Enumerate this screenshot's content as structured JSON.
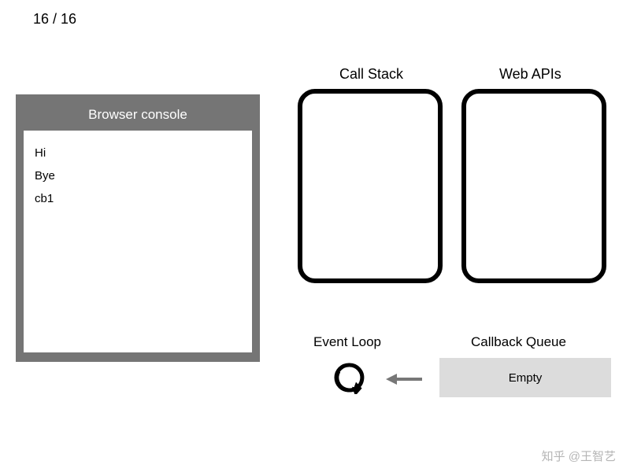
{
  "frame": {
    "current": 16,
    "total": 16,
    "separator": " / "
  },
  "console": {
    "title": "Browser console",
    "lines": [
      "Hi",
      "Bye",
      "cb1"
    ]
  },
  "labels": {
    "call_stack": "Call Stack",
    "web_apis": "Web APIs",
    "event_loop": "Event Loop",
    "callback_queue": "Callback Queue"
  },
  "callback_queue": {
    "status": "Empty"
  },
  "icons": {
    "loop": "loop-icon",
    "arrow": "arrow-left-icon"
  },
  "watermark": "知乎 @王智艺"
}
